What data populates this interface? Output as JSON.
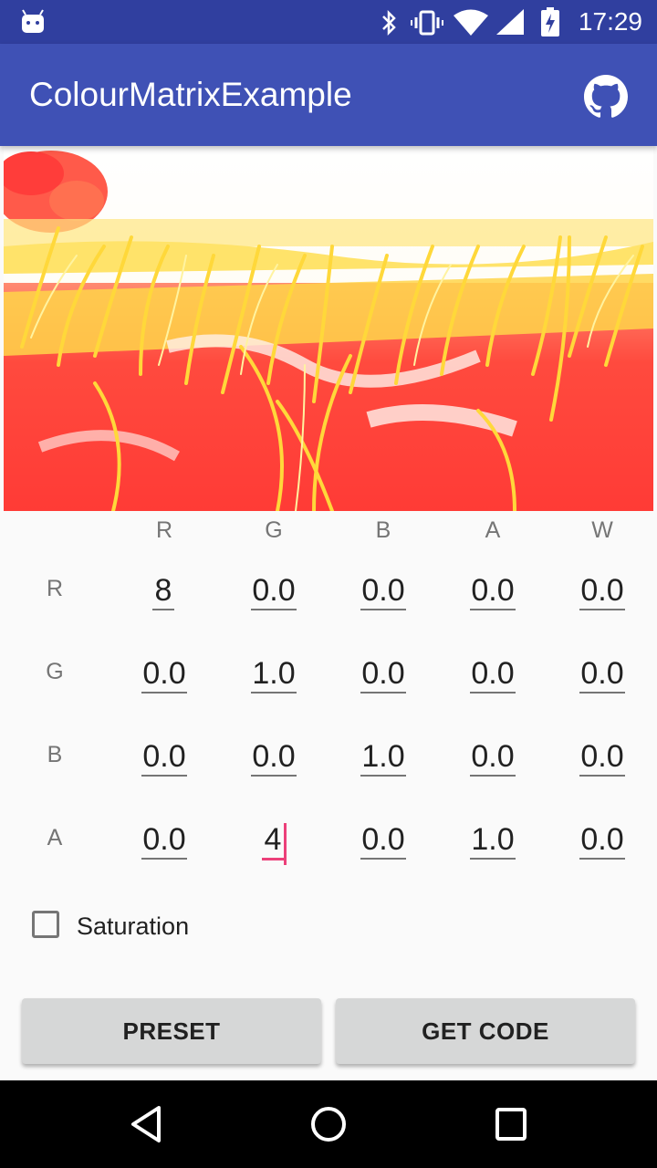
{
  "status": {
    "time": "17:29"
  },
  "app": {
    "title": "ColourMatrixExample"
  },
  "matrix": {
    "col_headers": [
      "R",
      "G",
      "B",
      "A",
      "W"
    ],
    "row_headers": [
      "R",
      "G",
      "B",
      "A"
    ],
    "rows": [
      [
        "8",
        "0.0",
        "0.0",
        "0.0",
        "0.0"
      ],
      [
        "0.0",
        "1.0",
        "0.0",
        "0.0",
        "0.0"
      ],
      [
        "0.0",
        "0.0",
        "1.0",
        "0.0",
        "0.0"
      ],
      [
        "0.0",
        "4",
        "0.0",
        "1.0",
        "0.0"
      ]
    ]
  },
  "saturation": {
    "label": "Saturation",
    "checked": false
  },
  "buttons": {
    "preset": "PRESET",
    "get_code": "GET CODE"
  },
  "colors": {
    "primary": "#3f51b5",
    "primary_dark": "#303f9f",
    "accent": "#ec407a"
  }
}
